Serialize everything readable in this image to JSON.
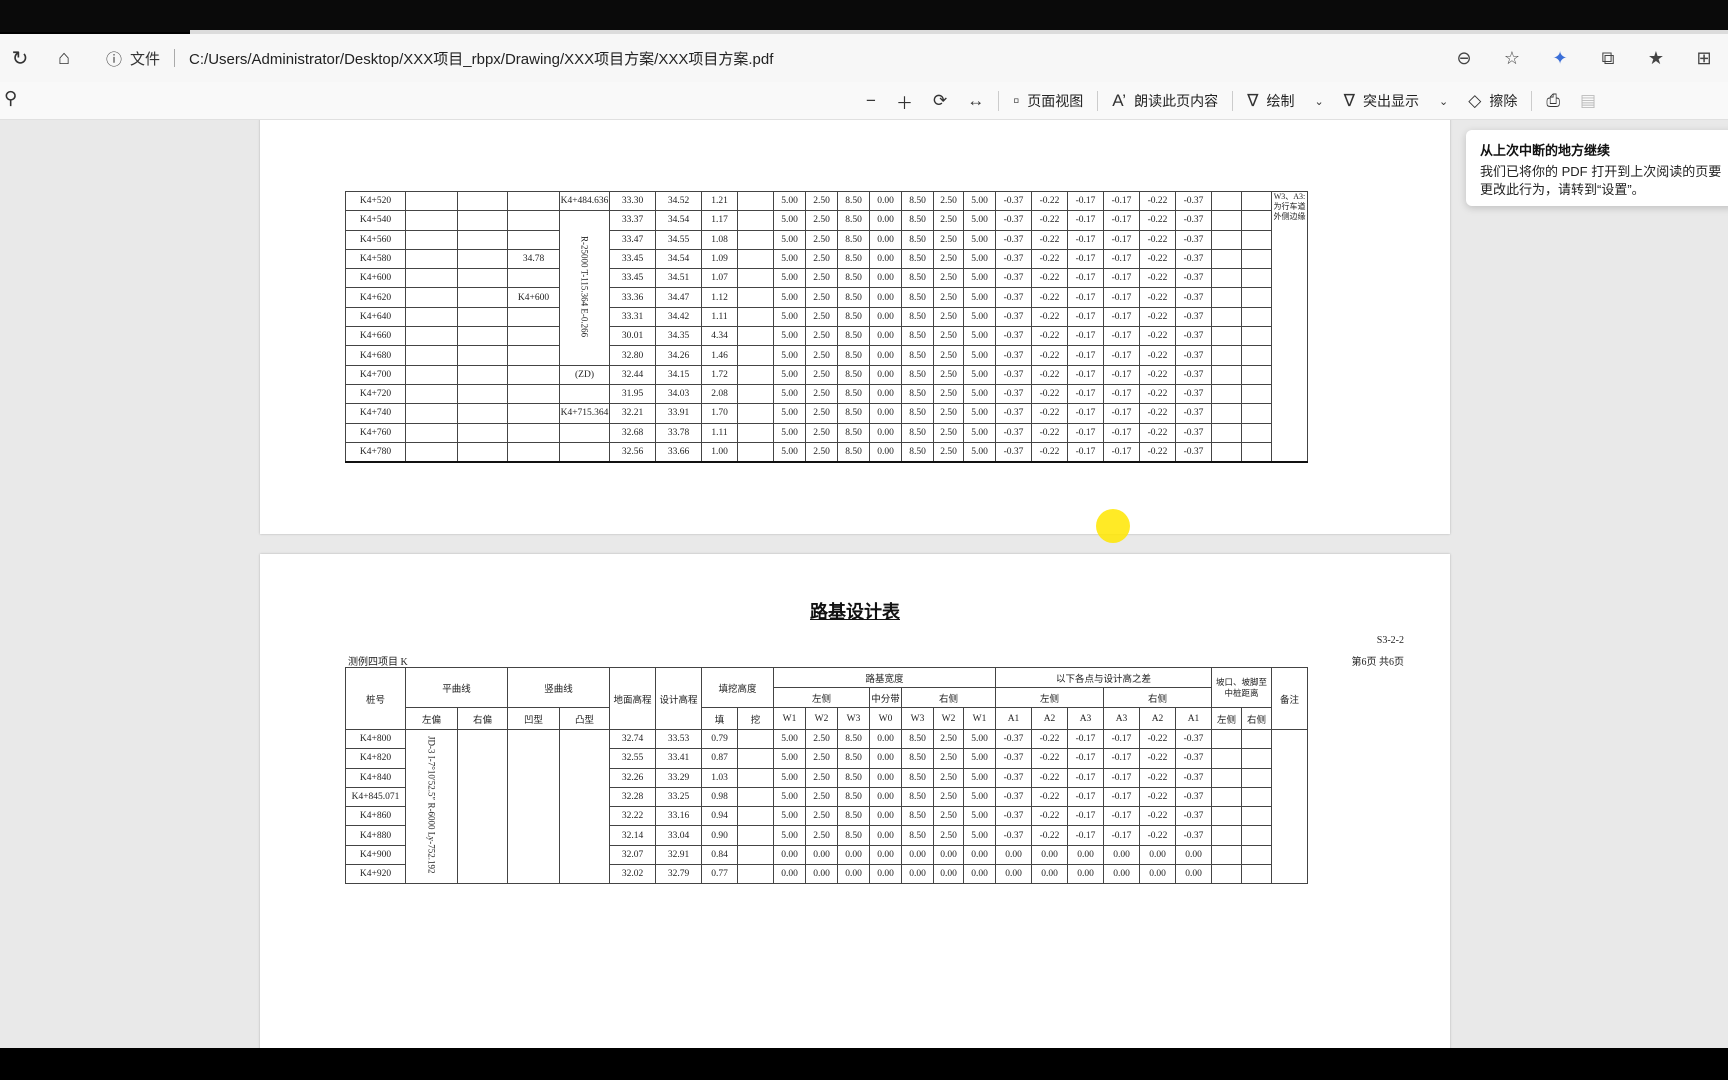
{
  "browser": {
    "file_label": "文件",
    "url": "C:/Users/Administrator/Desktop/XXX项目_rbpx/Drawing/XXX项目方案/XXX项目方案.pdf"
  },
  "pdf_toolbar": {
    "page_view": "页面视图",
    "read_aloud": "朗读此页内容",
    "draw": "绘制",
    "highlight": "突出显示",
    "erase": "擦除"
  },
  "toast": {
    "title": "从上次中断的地方继续",
    "body": "我们已将你的 PDF 打开到上次阅读的页要更改此行为，请转到“设置”。"
  },
  "page1": {
    "rows": [
      {
        "stake": "K4+520",
        "c1": "",
        "c2": "",
        "c3": "",
        "curve": "K4+484.636",
        "ground": "33.30",
        "design": "34.52",
        "fill": "1.21",
        "cut": "",
        "w1l": "5.00",
        "w2l": "2.50",
        "w3l": "8.50",
        "w0": "0.00",
        "w3r": "8.50",
        "w2r": "2.50",
        "w1r": "5.00",
        "a1l": "-0.37",
        "a2l": "-0.22",
        "a3l": "-0.17",
        "a3r": "-0.17",
        "a2r": "-0.22",
        "a1r": "-0.37",
        "note": "W3、A3: 为行车道外侧边缘"
      },
      {
        "stake": "K4+540",
        "c1": "",
        "c2": "",
        "c3": "",
        "curve": "",
        "ground": "33.37",
        "design": "34.54",
        "fill": "1.17",
        "cut": "",
        "w1l": "5.00",
        "w2l": "2.50",
        "w3l": "8.50",
        "w0": "0.00",
        "w3r": "8.50",
        "w2r": "2.50",
        "w1r": "5.00",
        "a1l": "-0.37",
        "a2l": "-0.22",
        "a3l": "-0.17",
        "a3r": "-0.17",
        "a2r": "-0.22",
        "a1r": "-0.37"
      },
      {
        "stake": "K4+560",
        "c1": "",
        "c2": "",
        "c3": "",
        "curve": "",
        "ground": "33.47",
        "design": "34.55",
        "fill": "1.08",
        "cut": "",
        "w1l": "5.00",
        "w2l": "2.50",
        "w3l": "8.50",
        "w0": "0.00",
        "w3r": "8.50",
        "w2r": "2.50",
        "w1r": "5.00",
        "a1l": "-0.37",
        "a2l": "-0.22",
        "a3l": "-0.17",
        "a3r": "-0.17",
        "a2r": "-0.22",
        "a1r": "-0.37"
      },
      {
        "stake": "K4+580",
        "c1": "",
        "c2": "",
        "c3": "34.78",
        "curve": "",
        "ground": "33.45",
        "design": "34.54",
        "fill": "1.09",
        "cut": "",
        "w1l": "5.00",
        "w2l": "2.50",
        "w3l": "8.50",
        "w0": "0.00",
        "w3r": "8.50",
        "w2r": "2.50",
        "w1r": "5.00",
        "a1l": "-0.37",
        "a2l": "-0.22",
        "a3l": "-0.17",
        "a3r": "-0.17",
        "a2r": "-0.22",
        "a1r": "-0.37"
      },
      {
        "stake": "K4+600",
        "c1": "",
        "c2": "",
        "c3": "",
        "curve": "",
        "ground": "33.45",
        "design": "34.51",
        "fill": "1.07",
        "cut": "",
        "w1l": "5.00",
        "w2l": "2.50",
        "w3l": "8.50",
        "w0": "0.00",
        "w3r": "8.50",
        "w2r": "2.50",
        "w1r": "5.00",
        "a1l": "-0.37",
        "a2l": "-0.22",
        "a3l": "-0.17",
        "a3r": "-0.17",
        "a2r": "-0.22",
        "a1r": "-0.37"
      },
      {
        "stake": "K4+620",
        "c1": "",
        "c2": "",
        "c3": "K4+600",
        "curve": "",
        "ground": "33.36",
        "design": "34.47",
        "fill": "1.12",
        "cut": "",
        "w1l": "5.00",
        "w2l": "2.50",
        "w3l": "8.50",
        "w0": "0.00",
        "w3r": "8.50",
        "w2r": "2.50",
        "w1r": "5.00",
        "a1l": "-0.37",
        "a2l": "-0.22",
        "a3l": "-0.17",
        "a3r": "-0.17",
        "a2r": "-0.22",
        "a1r": "-0.37"
      },
      {
        "stake": "K4+640",
        "c1": "",
        "c2": "",
        "c3": "",
        "curve": "",
        "ground": "33.31",
        "design": "34.42",
        "fill": "1.11",
        "cut": "",
        "w1l": "5.00",
        "w2l": "2.50",
        "w3l": "8.50",
        "w0": "0.00",
        "w3r": "8.50",
        "w2r": "2.50",
        "w1r": "5.00",
        "a1l": "-0.37",
        "a2l": "-0.22",
        "a3l": "-0.17",
        "a3r": "-0.17",
        "a2r": "-0.22",
        "a1r": "-0.37"
      },
      {
        "stake": "K4+660",
        "c1": "",
        "c2": "",
        "c3": "",
        "curve": "",
        "ground": "30.01",
        "design": "34.35",
        "fill": "4.34",
        "cut": "",
        "w1l": "5.00",
        "w2l": "2.50",
        "w3l": "8.50",
        "w0": "0.00",
        "w3r": "8.50",
        "w2r": "2.50",
        "w1r": "5.00",
        "a1l": "-0.37",
        "a2l": "-0.22",
        "a3l": "-0.17",
        "a3r": "-0.17",
        "a2r": "-0.22",
        "a1r": "-0.37"
      },
      {
        "stake": "K4+680",
        "c1": "",
        "c2": "",
        "c3": "",
        "curve": "",
        "ground": "32.80",
        "design": "34.26",
        "fill": "1.46",
        "cut": "",
        "w1l": "5.00",
        "w2l": "2.50",
        "w3l": "8.50",
        "w0": "0.00",
        "w3r": "8.50",
        "w2r": "2.50",
        "w1r": "5.00",
        "a1l": "-0.37",
        "a2l": "-0.22",
        "a3l": "-0.17",
        "a3r": "-0.17",
        "a2r": "-0.22",
        "a1r": "-0.37"
      },
      {
        "stake": "K4+700",
        "c1": "",
        "c2": "",
        "c3": "",
        "curve": "(ZD)",
        "ground": "32.44",
        "design": "34.15",
        "fill": "1.72",
        "cut": "",
        "w1l": "5.00",
        "w2l": "2.50",
        "w3l": "8.50",
        "w0": "0.00",
        "w3r": "8.50",
        "w2r": "2.50",
        "w1r": "5.00",
        "a1l": "-0.37",
        "a2l": "-0.22",
        "a3l": "-0.17",
        "a3r": "-0.17",
        "a2r": "-0.22",
        "a1r": "-0.37"
      },
      {
        "stake": "K4+720",
        "c1": "",
        "c2": "",
        "c3": "",
        "curve": "",
        "ground": "31.95",
        "design": "34.03",
        "fill": "2.08",
        "cut": "",
        "w1l": "5.00",
        "w2l": "2.50",
        "w3l": "8.50",
        "w0": "0.00",
        "w3r": "8.50",
        "w2r": "2.50",
        "w1r": "5.00",
        "a1l": "-0.37",
        "a2l": "-0.22",
        "a3l": "-0.17",
        "a3r": "-0.17",
        "a2r": "-0.22",
        "a1r": "-0.37"
      },
      {
        "stake": "K4+740",
        "c1": "",
        "c2": "",
        "c3": "",
        "curve": "K4+715.364",
        "ground": "32.21",
        "design": "33.91",
        "fill": "1.70",
        "cut": "",
        "w1l": "5.00",
        "w2l": "2.50",
        "w3l": "8.50",
        "w0": "0.00",
        "w3r": "8.50",
        "w2r": "2.50",
        "w1r": "5.00",
        "a1l": "-0.37",
        "a2l": "-0.22",
        "a3l": "-0.17",
        "a3r": "-0.17",
        "a2r": "-0.22",
        "a1r": "-0.37"
      },
      {
        "stake": "K4+760",
        "c1": "",
        "c2": "",
        "c3": "",
        "curve": "",
        "ground": "32.68",
        "design": "33.78",
        "fill": "1.11",
        "cut": "",
        "w1l": "5.00",
        "w2l": "2.50",
        "w3l": "8.50",
        "w0": "0.00",
        "w3r": "8.50",
        "w2r": "2.50",
        "w1r": "5.00",
        "a1l": "-0.37",
        "a2l": "-0.22",
        "a3l": "-0.17",
        "a3r": "-0.17",
        "a2r": "-0.22",
        "a1r": "-0.37"
      },
      {
        "stake": "K4+780",
        "c1": "",
        "c2": "",
        "c3": "",
        "curve": "",
        "ground": "32.56",
        "design": "33.66",
        "fill": "1.00",
        "cut": "",
        "w1l": "5.00",
        "w2l": "2.50",
        "w3l": "8.50",
        "w0": "0.00",
        "w3r": "8.50",
        "w2r": "2.50",
        "w1r": "5.00",
        "a1l": "-0.37",
        "a2l": "-0.22",
        "a3l": "-0.17",
        "a3r": "-0.17",
        "a2r": "-0.22",
        "a1r": "-0.37"
      }
    ],
    "curve_params": "R-25000 T-115.364 E-0.266"
  },
  "page2": {
    "title": "路基设计表",
    "code": "S3-2-2",
    "project": "测例四项目 K",
    "page_no": "第6页 共6页",
    "headers": {
      "stake": "桩号",
      "plane": "平曲线",
      "vertical": "竖曲线",
      "ground": "地面高程",
      "design": "设计高程",
      "fillcut": "填挖高度",
      "width": "路基宽度",
      "diff": "以下各点与设计高之差",
      "slope": "坡口、坡脚至中桩距离",
      "note": "备注",
      "left": "左侧",
      "median": "中分带",
      "right": "右侧",
      "left_bias": "左偏",
      "right_bias": "右偏",
      "concave": "凹型",
      "convex": "凸型",
      "fill": "填",
      "cut": "挖",
      "w1": "W1",
      "w2": "W2",
      "w3": "W3",
      "w0": "W0",
      "a1": "A1",
      "a2": "A2",
      "a3": "A3",
      "slope_left": "左侧",
      "slope_right": "右侧"
    },
    "curve_label": "JD-3 I-7°10′52.5″ R-6000 Ly-752.192",
    "rows": [
      {
        "stake": "K4+800",
        "ground": "32.74",
        "design": "33.53",
        "fill": "0.79",
        "w1l": "5.00",
        "w2l": "2.50",
        "w3l": "8.50",
        "w0": "0.00",
        "w3r": "8.50",
        "w2r": "2.50",
        "w1r": "5.00",
        "a1l": "-0.37",
        "a2l": "-0.22",
        "a3l": "-0.17",
        "a3r": "-0.17",
        "a2r": "-0.22",
        "a1r": "-0.37"
      },
      {
        "stake": "K4+820",
        "ground": "32.55",
        "design": "33.41",
        "fill": "0.87",
        "w1l": "5.00",
        "w2l": "2.50",
        "w3l": "8.50",
        "w0": "0.00",
        "w3r": "8.50",
        "w2r": "2.50",
        "w1r": "5.00",
        "a1l": "-0.37",
        "a2l": "-0.22",
        "a3l": "-0.17",
        "a3r": "-0.17",
        "a2r": "-0.22",
        "a1r": "-0.37"
      },
      {
        "stake": "K4+840",
        "ground": "32.26",
        "design": "33.29",
        "fill": "1.03",
        "w1l": "5.00",
        "w2l": "2.50",
        "w3l": "8.50",
        "w0": "0.00",
        "w3r": "8.50",
        "w2r": "2.50",
        "w1r": "5.00",
        "a1l": "-0.37",
        "a2l": "-0.22",
        "a3l": "-0.17",
        "a3r": "-0.17",
        "a2r": "-0.22",
        "a1r": "-0.37"
      },
      {
        "stake": "K4+845.071",
        "ground": "32.28",
        "design": "33.25",
        "fill": "0.98",
        "w1l": "5.00",
        "w2l": "2.50",
        "w3l": "8.50",
        "w0": "0.00",
        "w3r": "8.50",
        "w2r": "2.50",
        "w1r": "5.00",
        "a1l": "-0.37",
        "a2l": "-0.22",
        "a3l": "-0.17",
        "a3r": "-0.17",
        "a2r": "-0.22",
        "a1r": "-0.37"
      },
      {
        "stake": "K4+860",
        "ground": "32.22",
        "design": "33.16",
        "fill": "0.94",
        "w1l": "5.00",
        "w2l": "2.50",
        "w3l": "8.50",
        "w0": "0.00",
        "w3r": "8.50",
        "w2r": "2.50",
        "w1r": "5.00",
        "a1l": "-0.37",
        "a2l": "-0.22",
        "a3l": "-0.17",
        "a3r": "-0.17",
        "a2r": "-0.22",
        "a1r": "-0.37"
      },
      {
        "stake": "K4+880",
        "ground": "32.14",
        "design": "33.04",
        "fill": "0.90",
        "w1l": "5.00",
        "w2l": "2.50",
        "w3l": "8.50",
        "w0": "0.00",
        "w3r": "8.50",
        "w2r": "2.50",
        "w1r": "5.00",
        "a1l": "-0.37",
        "a2l": "-0.22",
        "a3l": "-0.17",
        "a3r": "-0.17",
        "a2r": "-0.22",
        "a1r": "-0.37"
      },
      {
        "stake": "K4+900",
        "ground": "32.07",
        "design": "32.91",
        "fill": "0.84",
        "w1l": "0.00",
        "w2l": "0.00",
        "w3l": "0.00",
        "w0": "0.00",
        "w3r": "0.00",
        "w2r": "0.00",
        "w1r": "0.00",
        "a1l": "0.00",
        "a2l": "0.00",
        "a3l": "0.00",
        "a3r": "0.00",
        "a2r": "0.00",
        "a1r": "0.00"
      },
      {
        "stake": "K4+920",
        "ground": "32.02",
        "design": "32.79",
        "fill": "0.77",
        "w1l": "0.00",
        "w2l": "0.00",
        "w3l": "0.00",
        "w0": "0.00",
        "w3r": "0.00",
        "w2r": "0.00",
        "w1r": "0.00",
        "a1l": "0.00",
        "a2l": "0.00",
        "a3l": "0.00",
        "a3r": "0.00",
        "a2r": "0.00",
        "a1r": "0.00"
      }
    ]
  }
}
